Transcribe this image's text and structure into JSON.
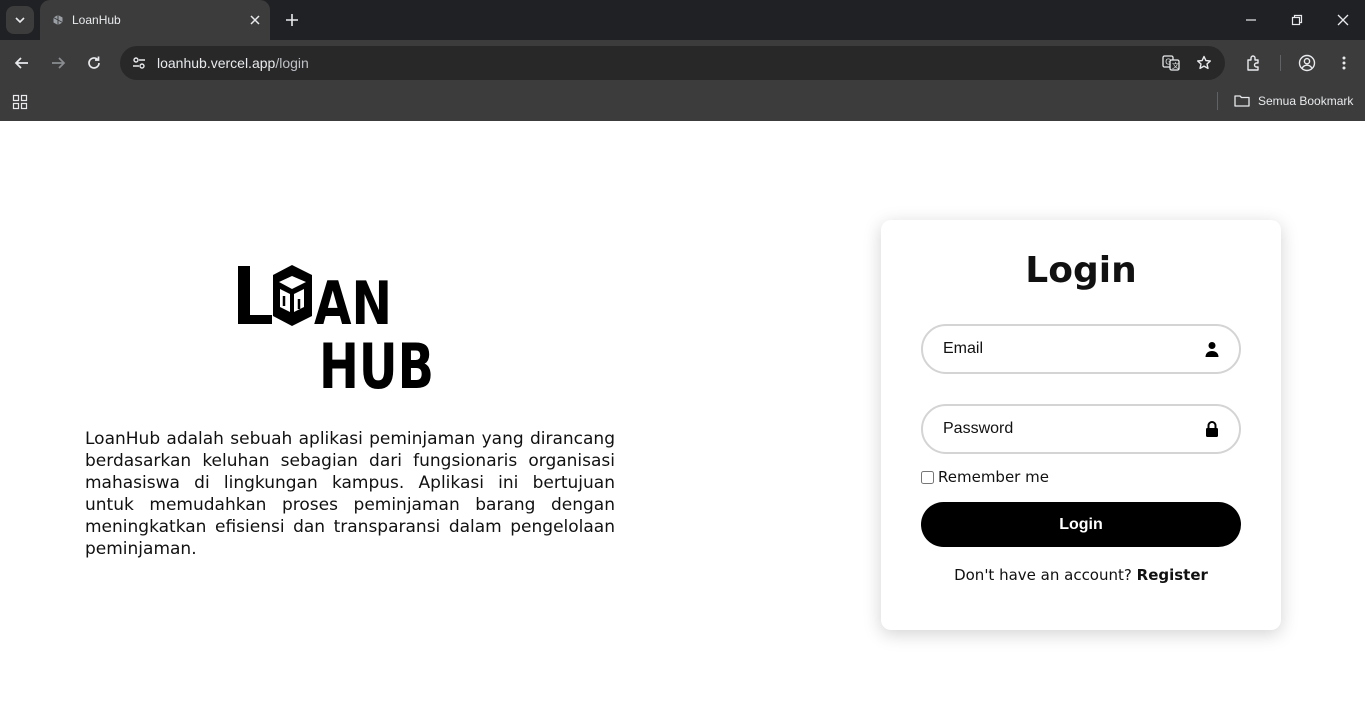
{
  "browser": {
    "tab": {
      "title": "LoanHub"
    },
    "url": {
      "host": "loanhub.vercel.app",
      "path": "/login"
    },
    "bookmarks": {
      "all_label": "Semua Bookmark"
    }
  },
  "hero": {
    "logo_text": "LOANHUB",
    "logo_line1": "LOAN",
    "logo_line2": "HUB",
    "description": "LoanHub adalah sebuah aplikasi peminjaman yang dirancang berdasarkan keluhan sebagian dari fungsionaris organisasi mahasiswa di lingkungan kampus. Aplikasi ini bertujuan untuk memudahkan proses peminjaman barang dengan meningkatkan efisiensi dan transparansi dalam pengelolaan peminjaman."
  },
  "login": {
    "title": "Login",
    "email_placeholder": "Email",
    "password_placeholder": "Password",
    "remember_label": "Remember me",
    "submit_label": "Login",
    "no_account_text": "Don't have an account?",
    "register_label": "Register"
  },
  "icons": {
    "email_field": "user-icon",
    "password_field": "lock-icon"
  }
}
